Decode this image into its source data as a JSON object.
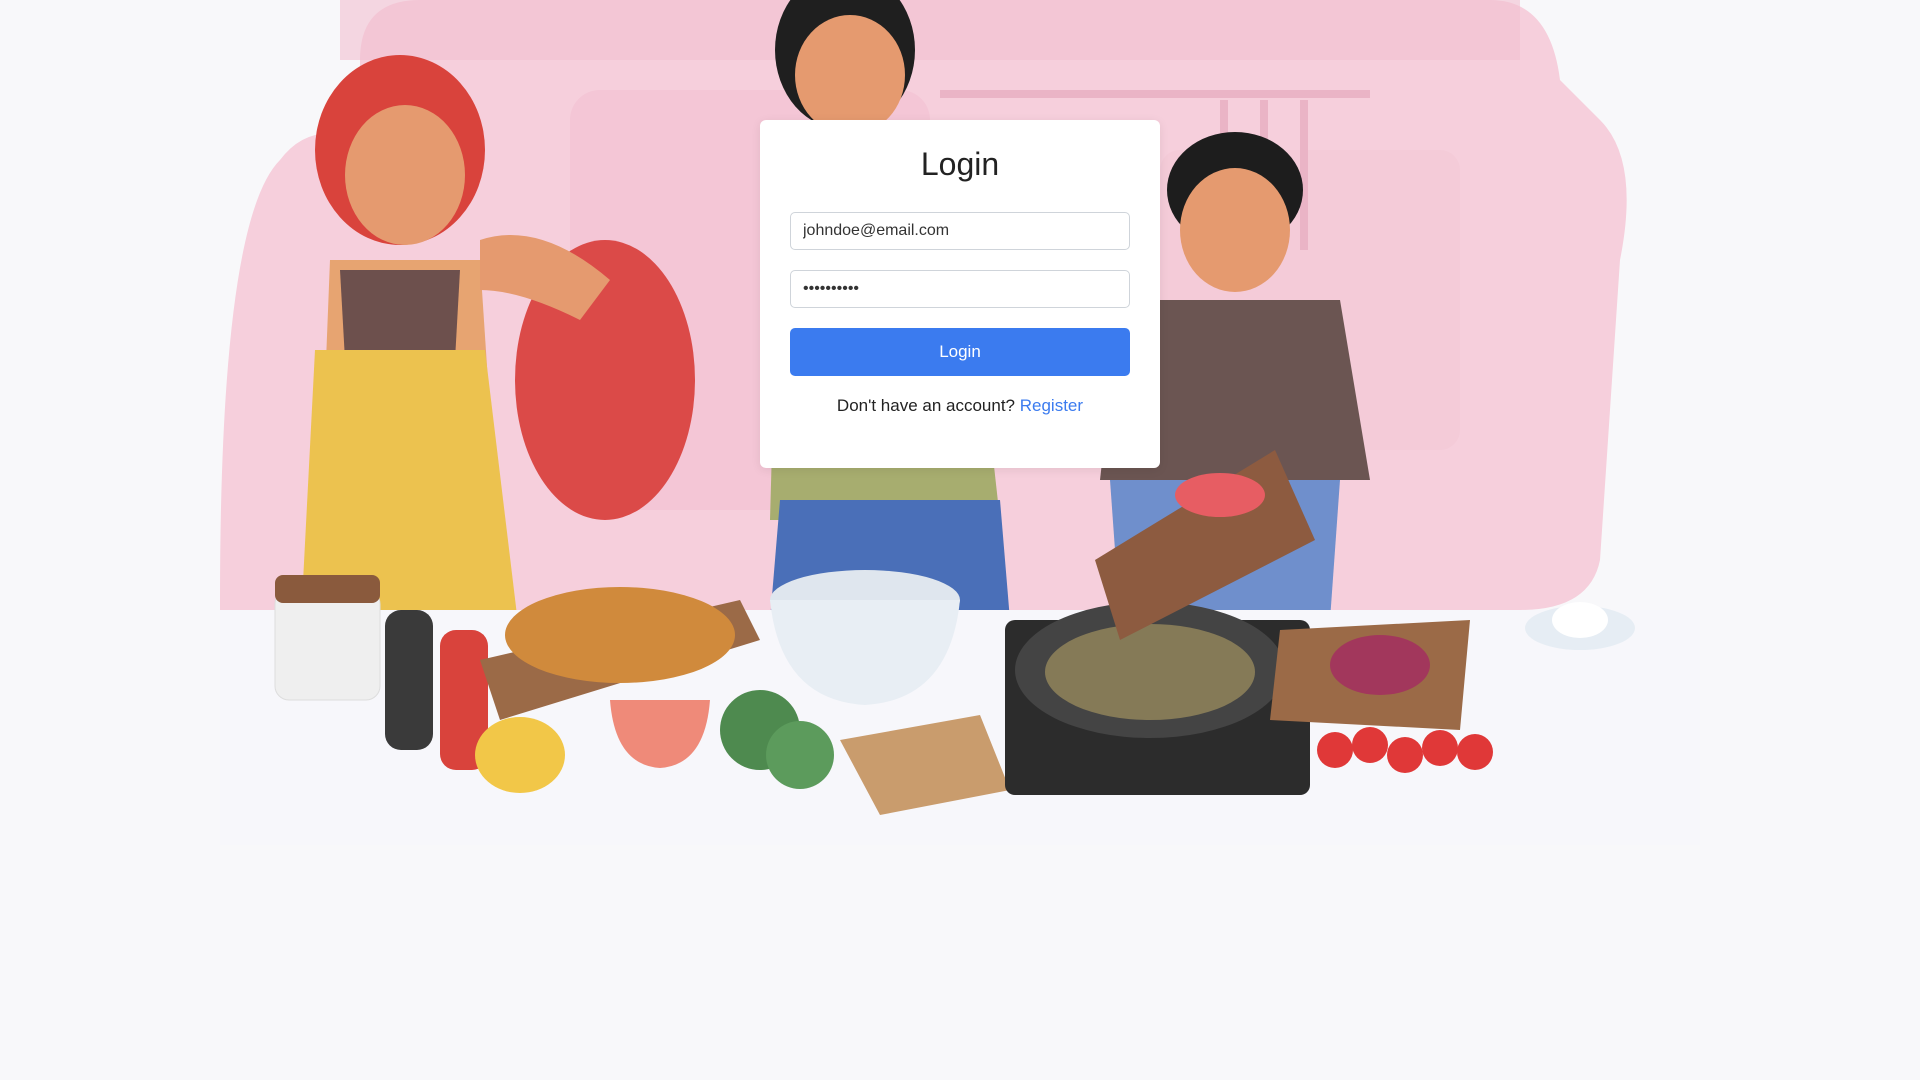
{
  "login": {
    "title": "Login",
    "email_value": "johndoe@email.com",
    "password_value": "••••••••••",
    "button_label": "Login",
    "prompt_text": "Don't have an account?",
    "register_link": "Register"
  },
  "colors": {
    "accent": "#3b7bef",
    "background": "#f8f8fa",
    "card": "#ffffff",
    "illustration_pink": "#f6cfdc"
  },
  "illustration": {
    "subject": "family-cooking-illustration"
  }
}
